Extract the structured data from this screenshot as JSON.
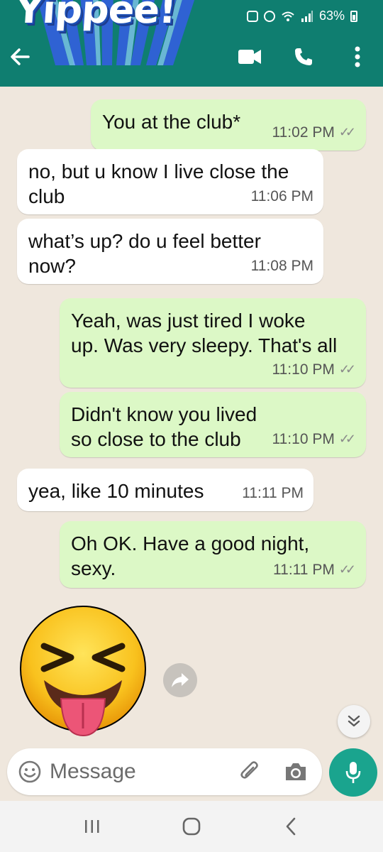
{
  "status_bar": {
    "battery": "63%"
  },
  "header": {
    "sticker_text": "Yippee!",
    "icons": [
      "back-arrow-icon",
      "video-call-icon",
      "phone-icon",
      "more-vert-icon"
    ]
  },
  "messages": [
    {
      "dir": "out",
      "text": "You at the club*",
      "time": "11:02 PM",
      "read": true
    },
    {
      "dir": "in",
      "text": "no, but u know I live close the club",
      "time": "11:06 PM"
    },
    {
      "dir": "in",
      "text": "what’s up? do u feel better now?",
      "time": "11:08 PM"
    },
    {
      "dir": "out",
      "text": "Yeah, was just tired I woke up. Was very sleepy. That's all",
      "time": "11:10 PM",
      "read": true
    },
    {
      "dir": "out",
      "text": "Didn't know you lived so close to the club",
      "time": "11:10 PM",
      "read": true
    },
    {
      "dir": "in",
      "text": "yea, like 10 minutes",
      "time": "11:11 PM"
    },
    {
      "dir": "out",
      "text": "Oh OK. Have a good night, sexy.",
      "time": "11:11 PM",
      "read": true
    }
  ],
  "sticker": {
    "emoji": "squinting-face-with-tongue"
  },
  "composer": {
    "placeholder": "Message"
  },
  "colors": {
    "header": "#0f7e70",
    "outgoing": "#dcf8c6",
    "incoming": "#ffffff",
    "mic": "#1aa48e"
  }
}
